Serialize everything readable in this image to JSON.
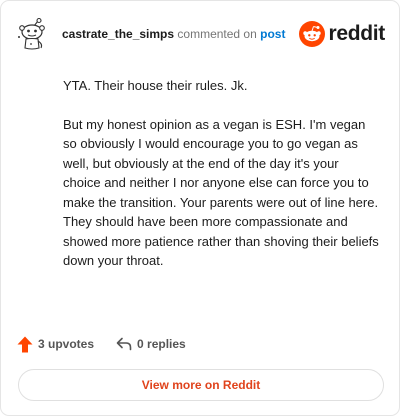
{
  "header": {
    "username": "castrate_the_simps",
    "commented_on": "commented on",
    "post_link": "post",
    "brand_word": "reddit"
  },
  "comment": {
    "paragraphs": [
      "YTA. Their house their rules. Jk.",
      "But my honest opinion as a vegan is ESH. I'm vegan so obviously I would encourage you to go vegan as well, but obviously at the end of the day it's your choice and neither I nor anyone else can force you to make the transition. Your parents were out of line here. They should have been more compassionate and showed more patience rather than shoving their beliefs down your throat."
    ]
  },
  "actions": {
    "upvotes": "3 upvotes",
    "replies": "0 replies"
  },
  "footer": {
    "view_more": "View more on Reddit"
  },
  "colors": {
    "brand_orange": "#ff4500",
    "link_blue": "#0079d3",
    "cta_text": "#e0431c"
  },
  "icons": {
    "avatar": "snoo-avatar-icon",
    "brand": "reddit-logo-icon",
    "upvote": "upvote-arrow-icon",
    "reply": "reply-arrow-icon"
  }
}
